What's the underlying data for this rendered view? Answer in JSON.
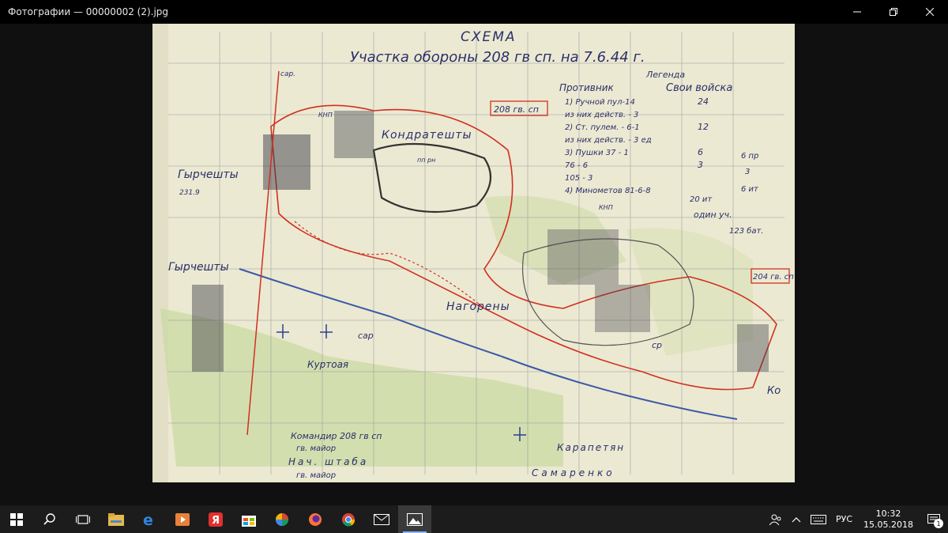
{
  "window": {
    "title": "Фотографии — 00000002 (2).jpg"
  },
  "map": {
    "title_line1": "СХЕМА",
    "title_line2": "Участка обороны 208 гв сп. на 7.6.44 г.",
    "legend_title": "Легенда",
    "legend_enemy": "Противник",
    "legend_own": "Свои войска",
    "legend_rows": [
      {
        "label": "1) Ручной пул-14",
        "value": "24"
      },
      {
        "label": "из них действ. - 3",
        "value": ""
      },
      {
        "label": "2) Ст. пулем. - 6-1",
        "value": "12"
      },
      {
        "label": "из них действ. - 3 ед",
        "value": ""
      },
      {
        "label": "3) Пушки 37 - 1",
        "value": "6"
      },
      {
        "label": "76 - 6",
        "value": "3"
      },
      {
        "label": "105 - 3",
        "value": ""
      },
      {
        "label": "4) Минометов 81-6-8",
        "value": ""
      }
    ],
    "legend_notes": [
      "6 пр",
      "3",
      "6 ит",
      "20 ит",
      "один уч.",
      "123 бат."
    ],
    "unit_box_top": "208 гв. сп",
    "unit_box_right": "204 гв. сп",
    "place_kondrateshty": "Кондратешты",
    "place_gyrcheshty": "Гырчешты",
    "place_gyrcheshty2": "Гырчешты",
    "place_nagoreny": "Нагорены",
    "place_kurtoaya": "Куртоая",
    "place_kar": "Ко",
    "height_label": "231.9",
    "sar_label1": "сар.",
    "sar_label2": "сар",
    "knp_label": "КНП",
    "knp_label2": "КНП",
    "csp_label": "ср",
    "pp_label": "пп рн",
    "signature_cmd1": "Командир 208 гв сп",
    "signature_cmd2": "гв. майор",
    "signature_chief1": "Нач. штаба",
    "signature_chief2": "гв. майор",
    "signature_name1": "Карапетян",
    "signature_name2": "Самаренко"
  },
  "taskbar": {
    "lang": "РУС",
    "time": "10:32",
    "date": "15.05.2018",
    "notif_count": "1",
    "apps": [
      "start-icon",
      "search-icon",
      "task-view-icon",
      "file-explorer-icon",
      "edge-icon",
      "media-player-icon",
      "yandex-browser-icon",
      "store-icon",
      "pinwheel-app-icon",
      "firefox-icon",
      "chrome-icon",
      "mail-icon",
      "photos-icon"
    ]
  }
}
